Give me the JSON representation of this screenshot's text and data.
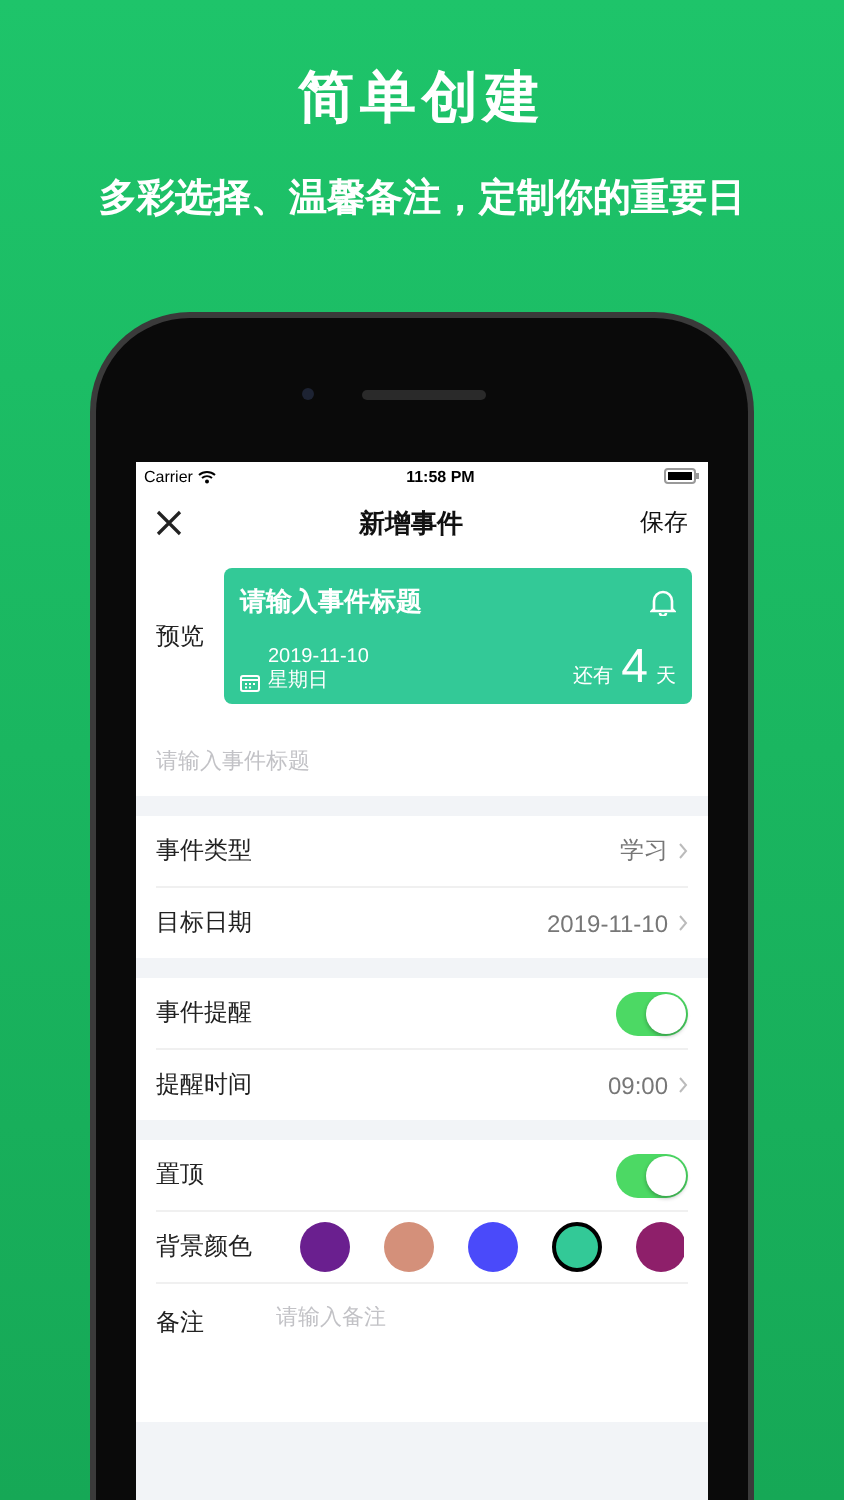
{
  "headline": "简单创建",
  "subtitle": "多彩选择、温馨备注，定制你的重要日",
  "status_bar": {
    "carrier": "Carrier",
    "time": "11:58 PM"
  },
  "nav": {
    "title": "新增事件",
    "action": "保存"
  },
  "preview": {
    "label": "预览",
    "title": "请输入事件标题",
    "date": "2019-11-10",
    "weekday": "星期日",
    "prefix": "还有",
    "days": "4",
    "unit": "天"
  },
  "title_field": {
    "placeholder": "请输入事件标题"
  },
  "sections": [
    {
      "rows": [
        {
          "kind": "value",
          "label": "事件类型",
          "value": "学习"
        },
        {
          "kind": "value",
          "label": "目标日期",
          "value": "2019-11-10"
        }
      ]
    },
    {
      "rows": [
        {
          "kind": "toggle",
          "label": "事件提醒",
          "on": true
        },
        {
          "kind": "value",
          "label": "提醒时间",
          "value": "09:00"
        }
      ]
    },
    {
      "rows": [
        {
          "kind": "toggle",
          "label": "置顶",
          "on": true
        },
        {
          "kind": "colors",
          "label": "背景颜色",
          "colors": [
            {
              "color": "#6a1f8f",
              "selected": false
            },
            {
              "color": "#d4907a",
              "selected": false
            },
            {
              "color": "#4a4afa",
              "selected": false
            },
            {
              "color": "#33c997",
              "selected": true
            },
            {
              "color": "#8e1f6a",
              "selected": false
            }
          ]
        },
        {
          "kind": "note",
          "label": "备注",
          "placeholder": "请输入备注"
        }
      ]
    }
  ]
}
